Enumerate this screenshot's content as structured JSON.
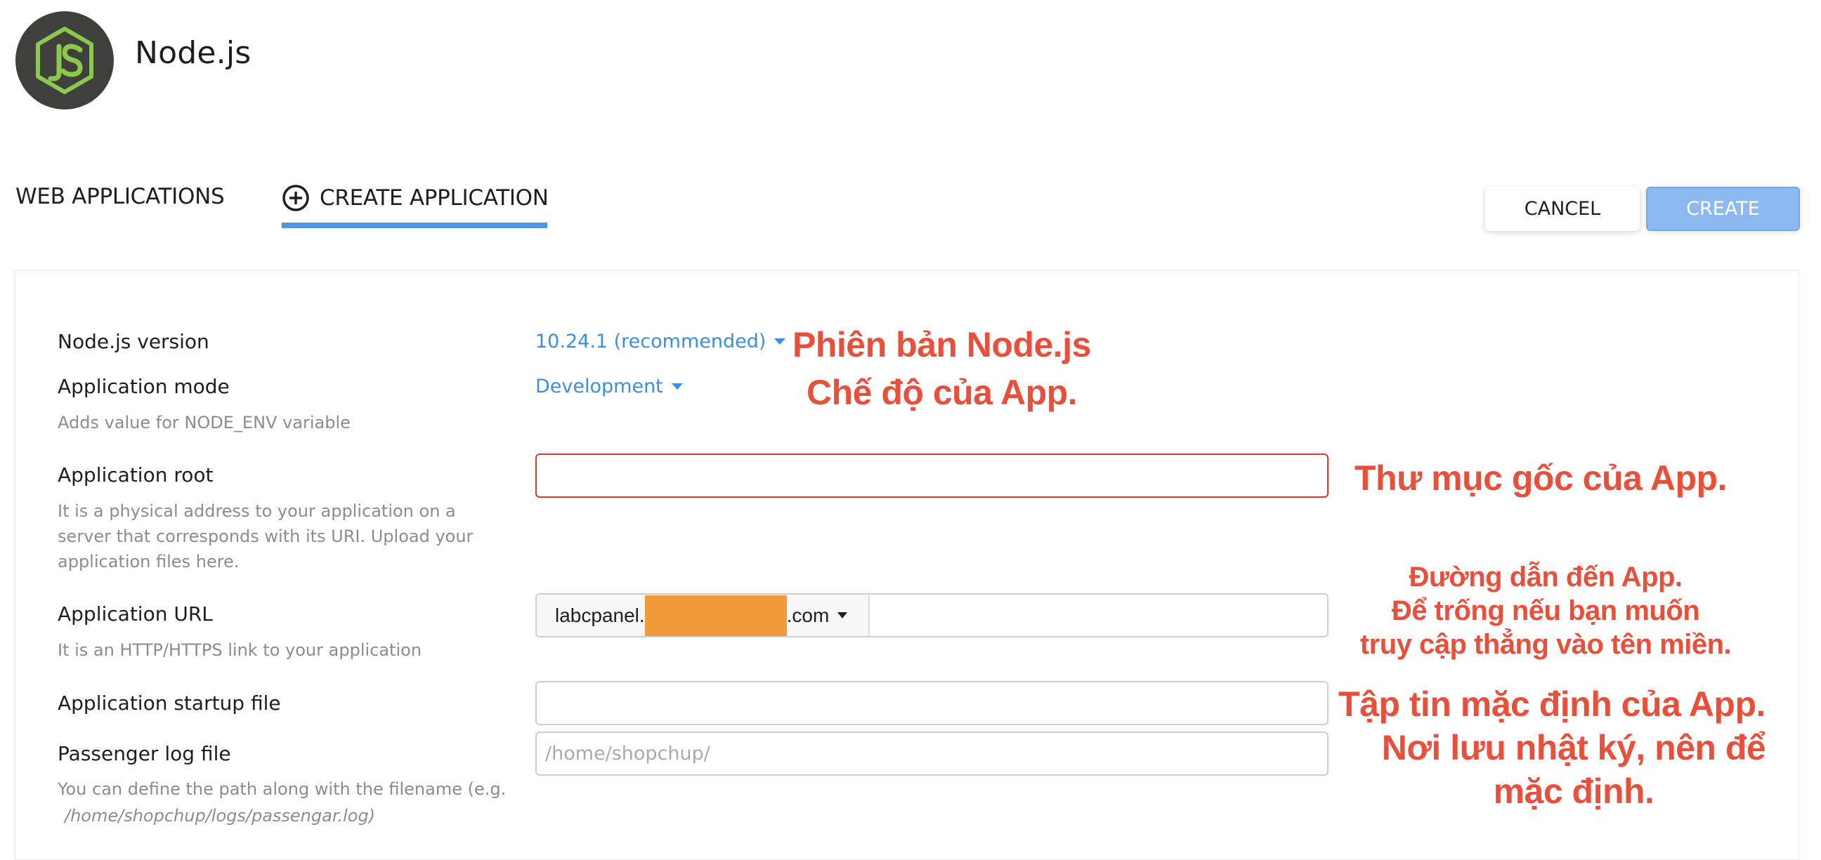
{
  "header": {
    "title": "Node.js",
    "logo_icon": "nodejs-logo-icon",
    "logo_colors": {
      "background": "#3f403c",
      "accent": "#8cc84b"
    }
  },
  "tabs": [
    {
      "label": "WEB APPLICATIONS",
      "active": false
    },
    {
      "label": "CREATE APPLICATION",
      "icon": "plus-circle-icon",
      "active": true
    }
  ],
  "actions": {
    "cancel_label": "CANCEL",
    "create_label": "CREATE"
  },
  "form": {
    "nodejs_version": {
      "label": "Node.js version",
      "value": "10.24.1 (recommended)"
    },
    "app_mode": {
      "label": "Application mode",
      "hint": "Adds value for NODE_ENV variable",
      "value": "Development"
    },
    "app_root": {
      "label": "Application root",
      "hint": "It is a physical address to your application on a server that corresponds with its URI. Upload your application files here.",
      "value": "",
      "state": "error"
    },
    "app_url": {
      "label": "Application URL",
      "hint": "It is an HTTP/HTTPS link to your application",
      "domain_prefix": "labcpanel.",
      "domain_suffix": ".com",
      "path_value": ""
    },
    "startup_file": {
      "label": "Application startup file",
      "value": ""
    },
    "log_file": {
      "label": "Passenger log file",
      "placeholder": "/home/shopchup/",
      "hint": "You can define the path along with the filename (e.g.",
      "hint_example": "/home/shopchup/logs/passengar.log)"
    }
  },
  "annotations": {
    "version": "Phiên bản Node.js",
    "mode": "Chế độ của App.",
    "root": "Thư mục gốc của App.",
    "url_line1": "Đường dẫn đến App.",
    "url_line2": "Để trống nếu bạn muốn",
    "url_line3": "truy cập thẳng vào tên miền.",
    "startup": "Tập tin mặc định của App.",
    "log_line1": "Nơi lưu nhật ký, nên để",
    "log_line2": "mặc định.",
    "color": "#e9503c"
  },
  "colors": {
    "accent": "#4f95e6",
    "link": "#3c8ee0",
    "create_button": "#8cbaf0",
    "error_border": "#e5332a",
    "redaction": "#f09a3a"
  }
}
